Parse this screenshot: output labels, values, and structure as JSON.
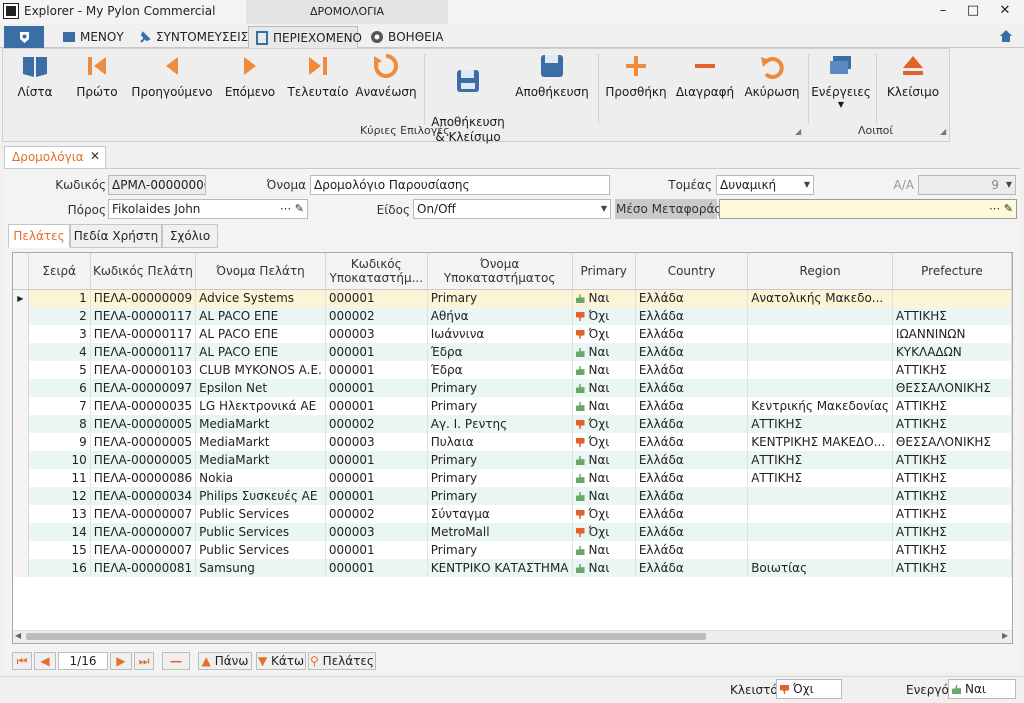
{
  "window": {
    "title": "Explorer - My Pylon Commercial",
    "context_tab": "ΔΡΟΜΟΛΟΓΙΑ"
  },
  "menu_tabs": [
    "ΜΕΝΟΥ",
    "ΣΥΝΤΟΜΕΥΣΕΙΣ",
    "ΠΕΡΙΕΧΟΜΕΝΟ",
    "ΒΟΗΘΕΙΑ"
  ],
  "ribbon": {
    "buttons": [
      "Λίστα",
      "Πρώτο",
      "Προηγούμενο",
      "Επόμενο",
      "Τελευταίο",
      "Ανανέωση",
      "Αποθήκευση\n& Κλείσιμο",
      "Αποθήκευση",
      "Προσθήκη",
      "Διαγραφή",
      "Ακύρωση",
      "Ενέργειες",
      "Κλείσιμο"
    ],
    "group_main": "Κύριες Επιλογές",
    "group_other": "Λοιποί"
  },
  "doc_tab": "Δρομολόγια",
  "form": {
    "code_label": "Κωδικός",
    "code_value": "ΔΡΜΛ-00000006",
    "name_label": "Όνομα",
    "name_value": "Δρομολόγιο Παρουσίασης",
    "sector_label": "Τομέας",
    "sector_value": "Δυναμική",
    "aa_label": "A/A",
    "aa_value": "9",
    "resource_label": "Πόρος",
    "resource_value": "Fikolaides John",
    "kind_label": "Είδος",
    "kind_value": "On/Off",
    "transport_label": "Μέσο Μεταφοράς",
    "transport_value": ""
  },
  "inner_tabs": [
    "Πελάτες",
    "Πεδία Χρήστη",
    "Σχόλιο"
  ],
  "grid": {
    "columns": [
      "Σειρά",
      "Κωδικός Πελάτη",
      "Όνομα Πελάτη",
      "Κωδικός Υποκαταστήμ...",
      "Όνομα Υποκαταστήματος",
      "Primary",
      "Country",
      "Region",
      "Prefecture"
    ],
    "rows": [
      [
        "1",
        "ΠΕΛΑ-00000009",
        "Advice Systems",
        "000001",
        "Primary",
        "Ναι",
        "Ελλάδα",
        "Ανατολικής Μακεδο...",
        ""
      ],
      [
        "2",
        "ΠΕΛΑ-00000117",
        "AL PACO ΕΠΕ",
        "000002",
        "Αθήνα",
        "Όχι",
        "Ελλάδα",
        "",
        "ΑΤΤΙΚΗΣ"
      ],
      [
        "3",
        "ΠΕΛΑ-00000117",
        "AL PACO ΕΠΕ",
        "000003",
        "Ιωάννινα",
        "Όχι",
        "Ελλάδα",
        "",
        "ΙΩΑΝΝΙΝΩΝ"
      ],
      [
        "4",
        "ΠΕΛΑ-00000117",
        "AL PACO ΕΠΕ",
        "000001",
        "Έδρα",
        "Ναι",
        "Ελλάδα",
        "",
        "ΚΥΚΛΑΔΩΝ"
      ],
      [
        "5",
        "ΠΕΛΑ-00000103",
        "CLUB MYKONOS A.E.",
        "000001",
        "Έδρα",
        "Ναι",
        "Ελλάδα",
        "",
        "ΑΤΤΙΚΗΣ"
      ],
      [
        "6",
        "ΠΕΛΑ-00000097",
        "Epsilon Net",
        "000001",
        "Primary",
        "Ναι",
        "Ελλάδα",
        "",
        "ΘΕΣΣΑΛΟΝΙΚΗΣ"
      ],
      [
        "7",
        "ΠΕΛΑ-00000035",
        "LG Ηλεκτρονικά ΑΕ",
        "000001",
        "Primary",
        "Ναι",
        "Ελλάδα",
        "Κεντρικής Μακεδονίας",
        "ΑΤΤΙΚΗΣ"
      ],
      [
        "8",
        "ΠΕΛΑ-00000005",
        "MediaMarkt",
        "000002",
        "Αγ. Ι. Ρεντης",
        "Όχι",
        "Ελλάδα",
        "ΑΤΤΙΚΗΣ",
        "ΑΤΤΙΚΗΣ"
      ],
      [
        "9",
        "ΠΕΛΑ-00000005",
        "MediaMarkt",
        "000003",
        "Πυλαια",
        "Όχι",
        "Ελλάδα",
        "ΚΕΝΤΡΙΚΗΣ ΜΑΚΕΔΟ...",
        "ΘΕΣΣΑΛΟΝΙΚΗΣ"
      ],
      [
        "10",
        "ΠΕΛΑ-00000005",
        "MediaMarkt",
        "000001",
        "Primary",
        "Ναι",
        "Ελλάδα",
        "ΑΤΤΙΚΗΣ",
        "ΑΤΤΙΚΗΣ"
      ],
      [
        "11",
        "ΠΕΛΑ-00000086",
        "Nokia",
        "000001",
        "Primary",
        "Ναι",
        "Ελλάδα",
        "ΑΤΤΙΚΗΣ",
        "ΑΤΤΙΚΗΣ"
      ],
      [
        "12",
        "ΠΕΛΑ-00000034",
        "Philips Συσκευές ΑΕ",
        "000001",
        "Primary",
        "Ναι",
        "Ελλάδα",
        "",
        "ΑΤΤΙΚΗΣ"
      ],
      [
        "13",
        "ΠΕΛΑ-00000007",
        "Public Services",
        "000002",
        "Σύνταγμα",
        "Όχι",
        "Ελλάδα",
        "",
        "ΑΤΤΙΚΗΣ"
      ],
      [
        "14",
        "ΠΕΛΑ-00000007",
        "Public Services",
        "000003",
        "MetroMall",
        "Όχι",
        "Ελλάδα",
        "",
        "ΑΤΤΙΚΗΣ"
      ],
      [
        "15",
        "ΠΕΛΑ-00000007",
        "Public Services",
        "000001",
        "Primary",
        "Ναι",
        "Ελλάδα",
        "",
        "ΑΤΤΙΚΗΣ"
      ],
      [
        "16",
        "ΠΕΛΑ-00000081",
        "Samsung",
        "000001",
        "ΚΕΝΤΡΙΚΟ ΚΑΤΑΣΤΗΜΑ",
        "Ναι",
        "Ελλάδα",
        "Βοιωτίας",
        "ΑΤΤΙΚΗΣ"
      ]
    ]
  },
  "pager": {
    "position": "1/16",
    "up": "Πάνω",
    "down": "Κάτω",
    "customers": "Πελάτες"
  },
  "status": {
    "closed_label": "Κλειστό",
    "closed_value": "Όχι",
    "active_label": "Ενεργό",
    "active_value": "Ναι"
  },
  "colors": {
    "accent": "#e36f2c",
    "ribbon_icon": "#3b6ea5",
    "yes": "#6aa86a",
    "no": "#e2622d"
  }
}
